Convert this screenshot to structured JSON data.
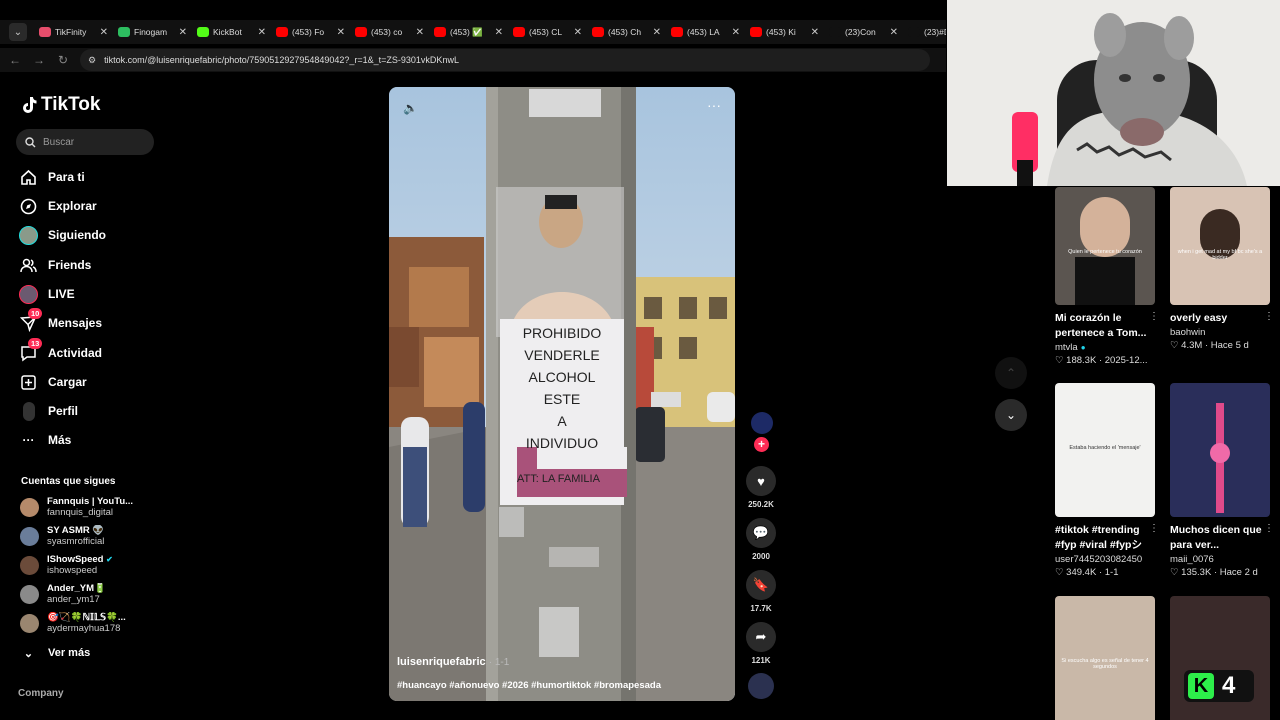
{
  "browser": {
    "tabs": [
      {
        "title": "TikFinity",
        "color": "#e64d6b"
      },
      {
        "title": "Finogam",
        "color": "#2dbe60"
      },
      {
        "title": "KickBot",
        "color": "#53fc18"
      },
      {
        "title": "(453) Fo",
        "color": "#ff0000"
      },
      {
        "title": "(453) co",
        "color": "#ff0000"
      },
      {
        "title": "(453) ✅",
        "color": "#ff0000"
      },
      {
        "title": "(453) CL",
        "color": "#ff0000"
      },
      {
        "title": "(453) Ch",
        "color": "#ff0000"
      },
      {
        "title": "(453) LA",
        "color": "#ff0000"
      },
      {
        "title": "(453) Ki",
        "color": "#ff0000"
      },
      {
        "title": "(23)Con",
        "color": "#111111"
      },
      {
        "title": "(23)#D",
        "color": "#111111"
      }
    ],
    "url": "tiktok.com/@luisenriquefabric/photo/7590512927954849042?_r=1&_t=ZS-9301vkDKnwL"
  },
  "sidebar": {
    "logo": "TikTok",
    "search_placeholder": "Buscar",
    "nav": [
      {
        "label": "Para ti",
        "icon": "home-icon"
      },
      {
        "label": "Explorar",
        "icon": "compass-icon"
      },
      {
        "label": "Siguiendo",
        "icon": "following-avatar-icon"
      },
      {
        "label": "Friends",
        "icon": "friends-icon"
      },
      {
        "label": "LIVE",
        "icon": "live-avatar-icon"
      },
      {
        "label": "Mensajes",
        "icon": "messages-icon",
        "badge": "10"
      },
      {
        "label": "Actividad",
        "icon": "activity-icon",
        "badge": "13"
      },
      {
        "label": "Cargar",
        "icon": "upload-icon"
      },
      {
        "label": "Perfil",
        "icon": "profile-avatar-icon"
      },
      {
        "label": "Más",
        "icon": "more-icon"
      }
    ],
    "following_title": "Cuentas que sigues",
    "following": [
      {
        "name": "Fannquis | YouTu...",
        "handle": "fannquis_digital",
        "color": "#b58a6a"
      },
      {
        "name": "SY ASMR 👽",
        "handle": "syasmrofficial",
        "color": "#6a7d9a"
      },
      {
        "name": "IShowSpeed",
        "handle": "ishowspeed",
        "color": "#6b4b3a",
        "verified": "✔"
      },
      {
        "name": "Ander_YM🔋",
        "handle": "ander_ym17",
        "color": "#8a8a8a"
      },
      {
        "name": "🎯🏹🍀ℕ𝕀𝕃𝕊🍀...",
        "handle": "aydermayhua178",
        "color": "#9a8670"
      }
    ],
    "see_more": "Ver más",
    "company": "Company"
  },
  "video": {
    "username": "luisenriquefabric",
    "date": "1-1",
    "tags": "#huancayo #añonuevo #2026 #humortiktok #bromapesada",
    "sign_lines": [
      "PROHIBIDO",
      "VENDERLE",
      "ALCOHOL",
      "ESTE",
      "A",
      "INDIVIDUO"
    ],
    "sign_att": "ATT: LA FAMILIA"
  },
  "actions": {
    "likes": "250.2K",
    "comments": "2000",
    "saves": "17.7K",
    "shares": "121K"
  },
  "recommendations": [
    {
      "title": "Mi corazón le pertenece a Tom...",
      "author": "mtvla",
      "verified": "●",
      "likes": "188.3K",
      "date": "2025-12...",
      "caption": "Quien le pertenece tu corazón"
    },
    {
      "title": "overly easy",
      "author": "baohwin",
      "likes": "4.3M",
      "date": "Hace 5 d",
      "caption": "when i get mad at my bf bc she's a bidder"
    },
    {
      "title": "#tiktok #trending #fyp #viral #fypシ",
      "author": "user7445203082450",
      "likes": "349.4K",
      "date": "1-1",
      "caption": "Estaba haciendo el 'mensaje'"
    },
    {
      "title": "Muchos dicen que para ver...",
      "author": "maii_0076",
      "likes": "135.3K",
      "date": "Hace 2 d",
      "caption": ""
    },
    {
      "title": "",
      "author": "",
      "likes": "",
      "date": "",
      "caption": "Si escucha algo es señal de tener 4 segundos"
    },
    {
      "title": "",
      "author": "",
      "likes": "",
      "date": "",
      "caption": ""
    }
  ],
  "kick_badge": {
    "count": "4"
  }
}
